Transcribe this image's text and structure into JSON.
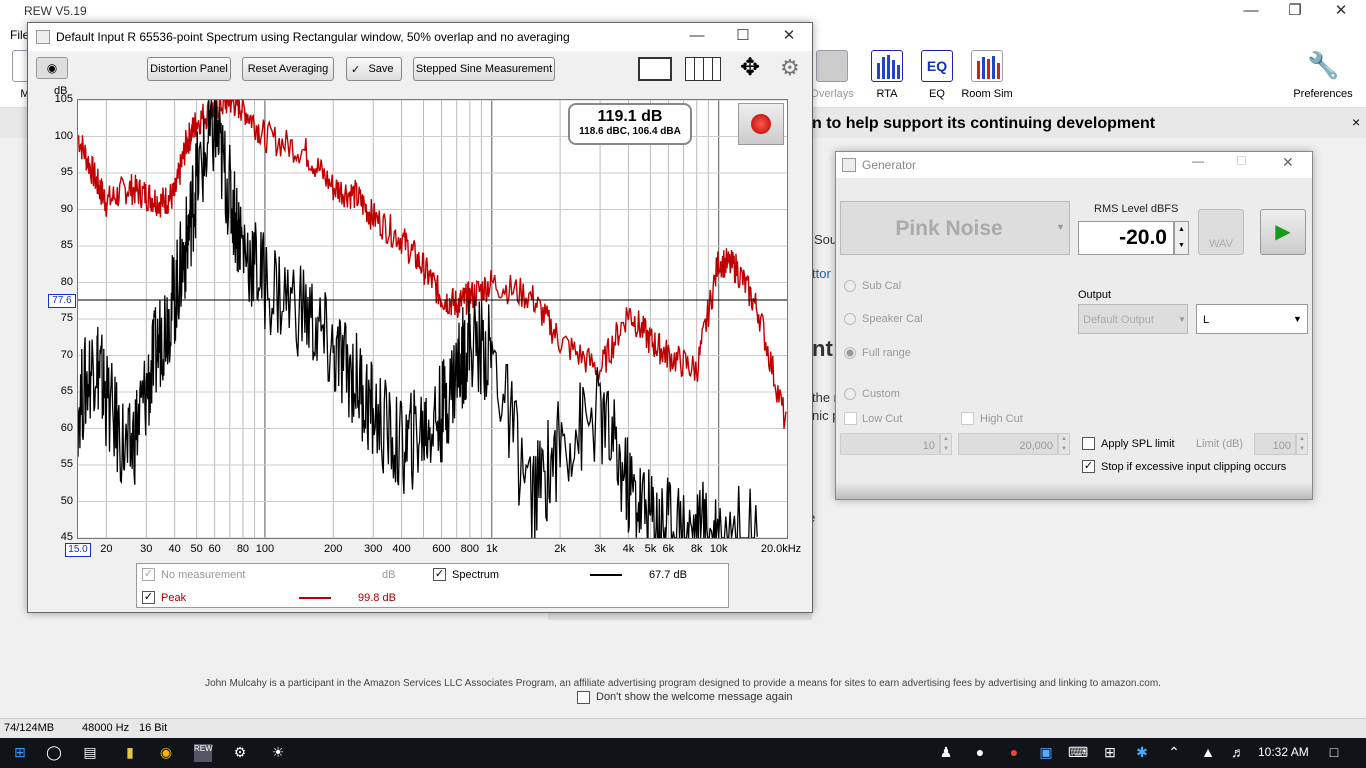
{
  "app": {
    "title": "REW V5.19",
    "menu_file": "File"
  },
  "toolbar": {
    "items": [
      "Overlays",
      "RTA",
      "EQ",
      "Room Sim",
      "Preferences"
    ],
    "left_label": "Me"
  },
  "banner": {
    "text": "n to help support its continuing development",
    "close": "×"
  },
  "background": {
    "snippets": [
      "Sou",
      "ttor",
      "nt",
      "the r",
      "nic p",
      "e"
    ]
  },
  "footer": {
    "amazon_text": "John Mulcahy is a participant in the Amazon Services LLC Associates Program, an affiliate advertising program designed to provide a means for sites to earn advertising fees by advertising and linking to amazon.com.",
    "dont_show": "Don't show the welcome message again"
  },
  "status": {
    "memory": "74/124MB",
    "rate": "48000 Hz",
    "bits": "16 Bit"
  },
  "taskbar": {
    "time": "10:32 AM"
  },
  "spectrum": {
    "title": "Default Input R 65536-point Spectrum using Rectangular window, 50% overlap and no averaging",
    "buttons": [
      "Distortion Panel",
      "Reset Averaging",
      "Save",
      "Stepped Sine Measurement"
    ],
    "readout_main": "119.1 dB",
    "readout_sub": "118.6 dBC, 106.4 dBA",
    "marker_value": "77.6",
    "x_start": "15.0",
    "legend": {
      "no_measurement": "No measurement",
      "no_measurement_unit": "dB",
      "spectrum": "Spectrum",
      "spectrum_value": "67.7 dB",
      "peak": "Peak",
      "peak_value": "99.8 dB"
    }
  },
  "chart_data": {
    "type": "line",
    "ylabel": "dB",
    "yticks": [
      "105",
      "100",
      "95",
      "90",
      "85",
      "80",
      "75",
      "70",
      "65",
      "60",
      "55",
      "50",
      "45"
    ],
    "xticks": [
      "20",
      "30",
      "40",
      "50",
      "60",
      "80",
      "100",
      "200",
      "300",
      "400",
      "600",
      "800",
      "1k",
      "2k",
      "3k",
      "4k",
      "5k",
      "6k",
      "8k",
      "10k",
      "20.0kHz"
    ],
    "ylim": [
      45,
      105
    ],
    "xlim": [
      15,
      20000
    ],
    "x_scale": "log",
    "series": [
      {
        "name": "Peak",
        "color": "#c00000",
        "x": [
          15,
          18,
          20,
          25,
          30,
          35,
          40,
          45,
          50,
          60,
          70,
          80,
          100,
          150,
          200,
          250,
          300,
          400,
          500,
          600,
          700,
          800,
          1000,
          1500,
          2000,
          3000,
          4000,
          5000,
          6000,
          8000,
          10000,
          12000,
          15000,
          20000
        ],
        "y": [
          100,
          94,
          91,
          93,
          92,
          91,
          92,
          99,
          102,
          104,
          105,
          104,
          100,
          98,
          93,
          92,
          89,
          86,
          82,
          78,
          77,
          78,
          80,
          78,
          72,
          68,
          76,
          72,
          70,
          68,
          83,
          82,
          76,
          60
        ]
      },
      {
        "name": "Spectrum",
        "color": "#000000",
        "x": [
          15,
          18,
          20,
          25,
          30,
          35,
          40,
          45,
          50,
          60,
          70,
          80,
          100,
          150,
          200,
          250,
          300,
          400,
          500,
          600,
          700,
          800,
          1000,
          1500,
          2000,
          3000,
          4000,
          5000,
          6000,
          8000,
          10000,
          15000
        ],
        "y": [
          63,
          70,
          64,
          56,
          65,
          73,
          78,
          85,
          94,
          101,
          92,
          85,
          80,
          76,
          70,
          67,
          62,
          57,
          60,
          62,
          68,
          72,
          70,
          50,
          58,
          62,
          52,
          48,
          47,
          46,
          46,
          45
        ]
      }
    ]
  },
  "generator": {
    "title": "Generator",
    "signal": "Pink Noise",
    "rms_label": "RMS Level dBFS",
    "rms_value": "-20.0",
    "wav": "WAV",
    "radios": [
      "Sub Cal",
      "Speaker Cal",
      "Full range",
      "Custom"
    ],
    "low_cut": "Low Cut",
    "high_cut": "High Cut",
    "low_val": "10",
    "high_val": "20,000",
    "output_label": "Output",
    "output_device": "Default Output",
    "output_channel": "L",
    "apply_spl": "Apply SPL limit",
    "limit_label": "Limit (dB)",
    "limit_value": "100",
    "stop_clip": "Stop if excessive input clipping occurs"
  }
}
